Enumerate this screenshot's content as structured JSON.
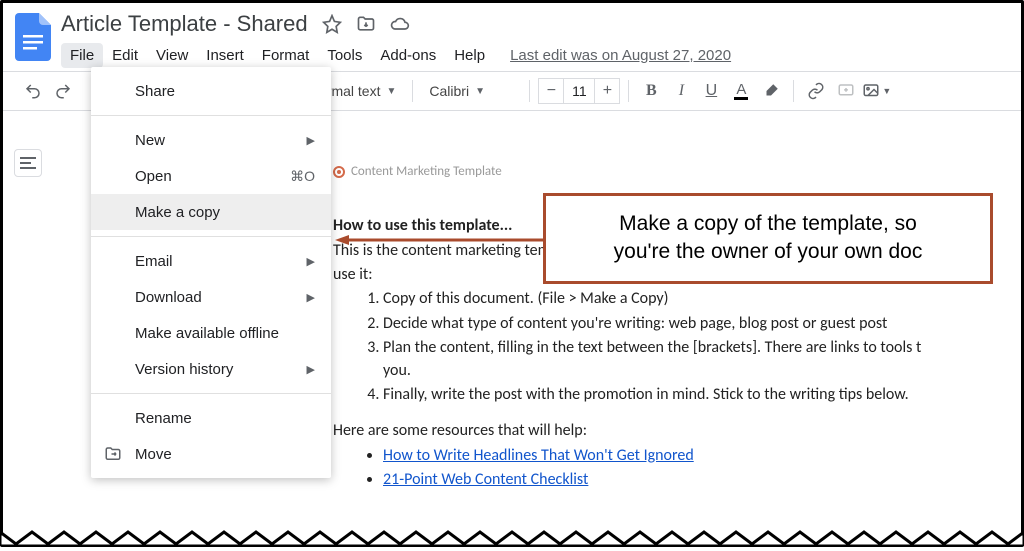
{
  "title": "Article Template - Shared",
  "menubar": [
    "File",
    "Edit",
    "View",
    "Insert",
    "Format",
    "Tools",
    "Add-ons",
    "Help"
  ],
  "last_edit": "Last edit was on August 27, 2020",
  "toolbar": {
    "style_dropdown": "ormal text",
    "font_dropdown": "Calibri",
    "font_size": "11"
  },
  "file_menu": {
    "share": "Share",
    "new": "New",
    "open": "Open",
    "open_shortcut": "⌘O",
    "make_copy": "Make a copy",
    "email": "Email",
    "download": "Download",
    "offline": "Make available offline",
    "version_history": "Version history",
    "rename": "Rename",
    "move": "Move"
  },
  "document": {
    "header_note": "Content Marketing Template",
    "heading": "How to use this template...",
    "intro_a": "This is the content marketing template we use at Orbit. We're happy to share it with you. H",
    "intro_b": "use it:",
    "steps": [
      "Copy of this document. (File > Make a Copy)",
      "Decide what type of content you're writing: web page, blog post or  guest post",
      "Plan the content, filling in the text between the [brackets]. There are links to tools t",
      "you.",
      "Finally, write the post with the promotion in mind. Stick to the writing tips below."
    ],
    "resources_intro": "Here are some resources that will help:",
    "resources": [
      "How to Write Headlines That Won't Get Ignored",
      "21-Point Web Content Checklist"
    ]
  },
  "callout": {
    "line1": "Make a copy of the template, so",
    "line2": "you're the owner of your own doc"
  }
}
